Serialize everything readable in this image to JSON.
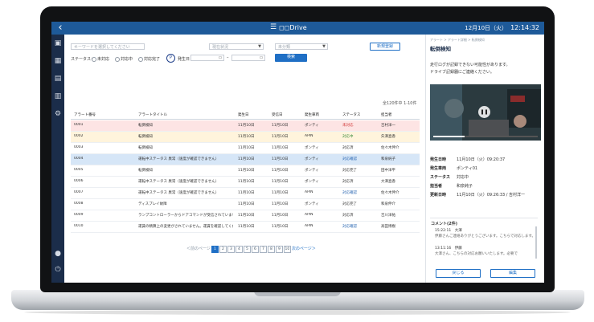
{
  "app": {
    "brand": "◻◻Drive",
    "date": "12月10日（火）",
    "time": "12:14:32"
  },
  "sidebar": {
    "icons": [
      "back-arrow-icon",
      "document-icon",
      "grid-icon",
      "video-icon",
      "chart-icon",
      "gear-icon",
      "person-icon",
      "power-icon"
    ]
  },
  "filters": {
    "keyword_placeholder": "キーワードを選択してください",
    "select1": "現在状況",
    "select2": "未分類",
    "select3": "",
    "status_label": "ステータス：",
    "status_options": [
      "未対応",
      "対応中",
      "対応完了"
    ],
    "badge": "P",
    "date_label": "発生日",
    "search_button": "検索",
    "new_button": "新規登録",
    "count_text": "全120件中 1-10件"
  },
  "table": {
    "columns": [
      "アラート番号",
      "アラートタイトル",
      "発生日",
      "受信日",
      "発生車両",
      "ステータス",
      "担当者"
    ],
    "rows": [
      [
        "0001",
        "転倒検知",
        "11月10日",
        "11月10日",
        "ポンティ",
        "未対応",
        "吉村洋一"
      ],
      [
        "0002",
        "転倒検知",
        "11月10日",
        "11月10日",
        "APIN",
        "対応中",
        "矢澤直香"
      ],
      [
        "0003",
        "転倒検知",
        "11月10日",
        "11月10日",
        "ポンティ",
        "対応済",
        "佐々木伸介"
      ],
      [
        "0004",
        "運転中ステータス 異常（速度が確認できません）",
        "11月10日",
        "11月10日",
        "ポンティ",
        "対応確認",
        "和泉純子"
      ],
      [
        "0005",
        "転倒検知",
        "11月10日",
        "11月10日",
        "ポンティ",
        "対応完了",
        "田中洋平"
      ],
      [
        "0006",
        "運転中ステータス 異常（速度が確認できません）",
        "11月10日",
        "11月10日",
        "ポンティ",
        "対応済",
        "大澤直香"
      ],
      [
        "0007",
        "運転中ステータス 異常（速度が確認できません）",
        "11月10日",
        "11月10日",
        "APIN",
        "対応確認",
        "佐々木伸介"
      ],
      [
        "0008",
        "ディスプレイ故障",
        "11月10日",
        "11月10日",
        "ポンティ",
        "対応完了",
        "和泉伸介"
      ],
      [
        "0009",
        "ランプコントローラーからドアコマンドが受信されていません",
        "11月10日",
        "11月10日",
        "APIN",
        "対応済",
        "吉川洋祐"
      ],
      [
        "0010",
        "運賃の精算上の変更がされていません。運賃を確認してください",
        "11月10日",
        "11月10日",
        "APIN",
        "対応確認",
        "高田博樹"
      ]
    ]
  },
  "pager": {
    "prev": "＜前のページ",
    "pages": [
      "1",
      "2",
      "3",
      "4",
      "5",
      "6",
      "7",
      "8",
      "9",
      "10"
    ],
    "next": "次のページ＞"
  },
  "detail": {
    "crumb": "アラート > アラート詳細 > 転倒検知",
    "title": "転倒検知",
    "message1": "走行ログが記録できない可能性があります。",
    "message2": "ドライブ記録器にご連絡ください。",
    "video_progress": 0.3,
    "fields": [
      {
        "label": "発生日時",
        "value": "11月10日（火）09:20:37"
      },
      {
        "label": "発生車両",
        "value": "ポンティ01"
      },
      {
        "label": "ステータス",
        "value": "対応中"
      },
      {
        "label": "担当者",
        "value": "和泉純子"
      },
      {
        "label": "更新日時",
        "value": "11月10日（火）09:26:33 / 吉村洋一"
      }
    ],
    "comments_title": "コメント(2件)",
    "comments": [
      {
        "meta": "15:22:11　大澤",
        "text": "伊藤さんご連絡ありがとうございます。こちらで対応します。"
      },
      {
        "meta": "13:11:16　伊藤",
        "text": "大澤さん、こちらの対応お願いいたします。必要で"
      }
    ],
    "btn_left": "戻じる",
    "btn_right": "編集"
  }
}
